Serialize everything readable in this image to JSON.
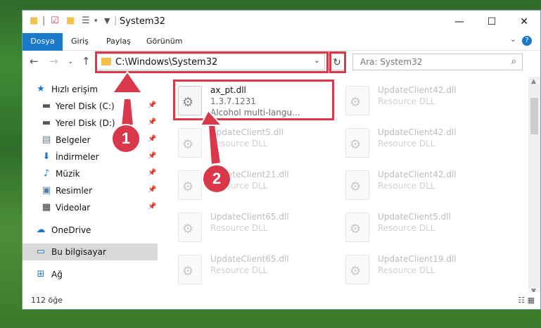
{
  "window": {
    "title": "System32"
  },
  "colors": {
    "accent": "#1979ca",
    "highlight": "#d9384a"
  },
  "ribbon": {
    "tabs": [
      {
        "label": "Dosya"
      },
      {
        "label": "Giriş"
      },
      {
        "label": "Paylaş"
      },
      {
        "label": "Görünüm"
      }
    ]
  },
  "navigation": {
    "address": "C:\\Windows\\System32",
    "search_placeholder": "Ara: System32"
  },
  "sidebar": {
    "items": [
      {
        "label": "Hızlı erişim",
        "icon": "star-icon"
      },
      {
        "label": "Yerel Disk (C:)",
        "icon": "drive-icon"
      },
      {
        "label": "Yerel Disk (D:)",
        "icon": "drive-icon"
      },
      {
        "label": "Belgeler",
        "icon": "documents-icon"
      },
      {
        "label": "İndirmeler",
        "icon": "download-icon"
      },
      {
        "label": "Müzik",
        "icon": "music-icon"
      },
      {
        "label": "Resimler",
        "icon": "pictures-icon"
      },
      {
        "label": "Videolar",
        "icon": "video-icon"
      },
      {
        "label": "OneDrive",
        "icon": "cloud-icon"
      },
      {
        "label": "Bu bilgisayar",
        "icon": "computer-icon"
      },
      {
        "label": "Ağ",
        "icon": "network-icon"
      }
    ]
  },
  "files": [
    {
      "name": "ax_pt.dll",
      "line2": "1.3.7.1231",
      "line3": "Alcohol multi-langu..."
    },
    {
      "name": "UpdateClient42.dll",
      "line2": "Resource DLL"
    },
    {
      "name": "UpdateClient5.dll",
      "line2": "Resource DLL"
    },
    {
      "name": "UpdateClient42.dll",
      "line2": "Resource DLL"
    },
    {
      "name": "UpdateClient21.dll",
      "line2": "Resource DLL"
    },
    {
      "name": "UpdateClient42.dll",
      "line2": "Resource DLL"
    },
    {
      "name": "UpdateClient65.dll",
      "line2": "Resource DLL"
    },
    {
      "name": "UpdateClient5.dll",
      "line2": "Resource DLL"
    },
    {
      "name": "UpdateClient65.dll",
      "line2": "Resource DLL"
    },
    {
      "name": "UpdateClient19.dll",
      "line2": "Resource DLL"
    }
  ],
  "status": {
    "count": "112 öğe"
  },
  "callouts": [
    {
      "label": "1"
    },
    {
      "label": "2"
    }
  ]
}
